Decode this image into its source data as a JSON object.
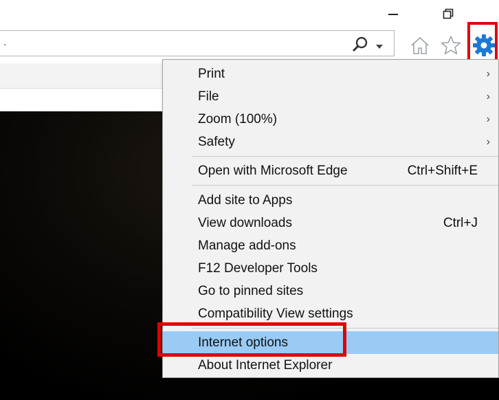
{
  "window": {
    "minimize_icon": "minimize-icon",
    "restore_icon": "restore-icon"
  },
  "address_bar": {
    "value": ".",
    "search_icon": "search-icon",
    "dropdown_icon": "chevron-down-icon"
  },
  "toolbar": {
    "home_icon": "home-icon",
    "favorites_icon": "star-icon",
    "tools_icon": "gear-icon",
    "tools_color": "#1c7ad4"
  },
  "tools_menu": {
    "items": [
      {
        "label": "Print",
        "shortcut": "",
        "submenu": true
      },
      {
        "label": "File",
        "shortcut": "",
        "submenu": true
      },
      {
        "label": "Zoom (100%)",
        "shortcut": "",
        "submenu": true
      },
      {
        "label": "Safety",
        "shortcut": "",
        "submenu": true
      },
      {
        "label": "Open with Microsoft Edge",
        "shortcut": "Ctrl+Shift+E",
        "submenu": false
      },
      {
        "label": "Add site to Apps",
        "shortcut": "",
        "submenu": false
      },
      {
        "label": "View downloads",
        "shortcut": "Ctrl+J",
        "submenu": false
      },
      {
        "label": "Manage add-ons",
        "shortcut": "",
        "submenu": false
      },
      {
        "label": "F12 Developer Tools",
        "shortcut": "",
        "submenu": false
      },
      {
        "label": "Go to pinned sites",
        "shortcut": "",
        "submenu": false
      },
      {
        "label": "Compatibility View settings",
        "shortcut": "",
        "submenu": false
      },
      {
        "label": "Internet options",
        "shortcut": "",
        "submenu": false,
        "highlighted": true
      },
      {
        "label": "About Internet Explorer",
        "shortcut": "",
        "submenu": false
      }
    ],
    "submenu_arrow": "›",
    "highlight_color": "#99cbf5",
    "callout_color": "#e00000"
  }
}
